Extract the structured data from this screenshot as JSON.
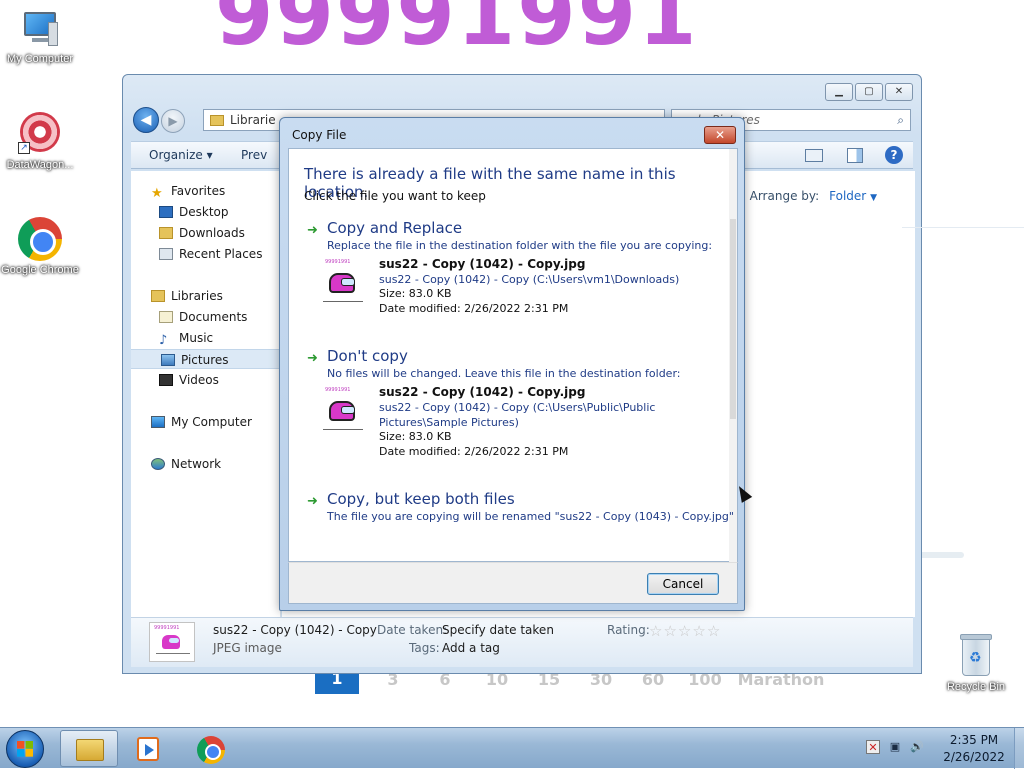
{
  "desktop": {
    "bg_number": "99991991",
    "pager": [
      "1",
      "3",
      "6",
      "10",
      "15",
      "30",
      "60",
      "100",
      "Marathon"
    ],
    "icons": [
      {
        "label": "My Computer",
        "icon": "computer-icon"
      },
      {
        "label": "DataWagon...",
        "icon": "datawagon-icon"
      },
      {
        "label": "Google Chrome",
        "icon": "chrome-icon"
      },
      {
        "label": "Recycle Bin",
        "icon": "recycle-bin-icon"
      }
    ]
  },
  "explorer": {
    "address": "Libraries ▸ Pictures ▸ Sample Pictures",
    "address_visible": "Librarie",
    "search_placeholder": "Search Sample Pictures",
    "search_visible": "mple Pictures",
    "toolbar": {
      "organize": "Organize ▾",
      "preview": "Prev"
    },
    "arrange_by_label": "Arrange by:",
    "arrange_by_value": "Folder",
    "sidebar": {
      "favorites": "Favorites",
      "desktop": "Desktop",
      "downloads": "Downloads",
      "recent_places": "Recent Places",
      "libraries": "Libraries",
      "documents": "Documents",
      "music": "Music",
      "pictures": "Pictures",
      "videos": "Videos",
      "my_computer": "My Computer",
      "network": "Network"
    },
    "details": {
      "name": "sus22 - Copy (1042) - Copy",
      "type": "JPEG image",
      "date_taken_label": "Date taken:",
      "date_taken_value": "Specify date taken",
      "tags_label": "Tags:",
      "tags_value": "Add a tag",
      "rating_label": "Rating:",
      "rating_value": 0
    }
  },
  "dialog": {
    "title": "Copy File",
    "close": "✕",
    "heading": "There is already a file with the same name in this location.",
    "subheading": "Click the file you want to keep",
    "options": [
      {
        "title": "Copy and Replace",
        "desc": "Replace the file in the destination folder with the file you are copying:",
        "file_name": "sus22 - Copy (1042) - Copy.jpg",
        "file_path": "sus22 - Copy (1042) - Copy (C:\\Users\\vm1\\Downloads)",
        "size": "Size: 83.0 KB",
        "modified": "Date modified: 2/26/2022 2:31 PM"
      },
      {
        "title": "Don't copy",
        "desc": "No files will be changed. Leave this file in the destination folder:",
        "file_name": "sus22 - Copy (1042) - Copy.jpg",
        "file_path": "sus22 - Copy (1042) - Copy (C:\\Users\\Public\\Public Pictures\\Sample Pictures)",
        "size": "Size: 83.0 KB",
        "modified": "Date modified: 2/26/2022 2:31 PM"
      },
      {
        "title": "Copy, but keep both files",
        "desc": "The file you are copying will be renamed \"sus22 - Copy (1043) - Copy.jpg\""
      }
    ],
    "thumb_text": "99991991",
    "cancel": "Cancel"
  },
  "taskbar": {
    "time": "2:35 PM",
    "date": "2/26/2022"
  },
  "colors": {
    "dialog_link": "#1f3b86",
    "arrow_green": "#2d9a32",
    "bg_number": "#c05cd6",
    "taskbar": "#9ab8d6"
  }
}
